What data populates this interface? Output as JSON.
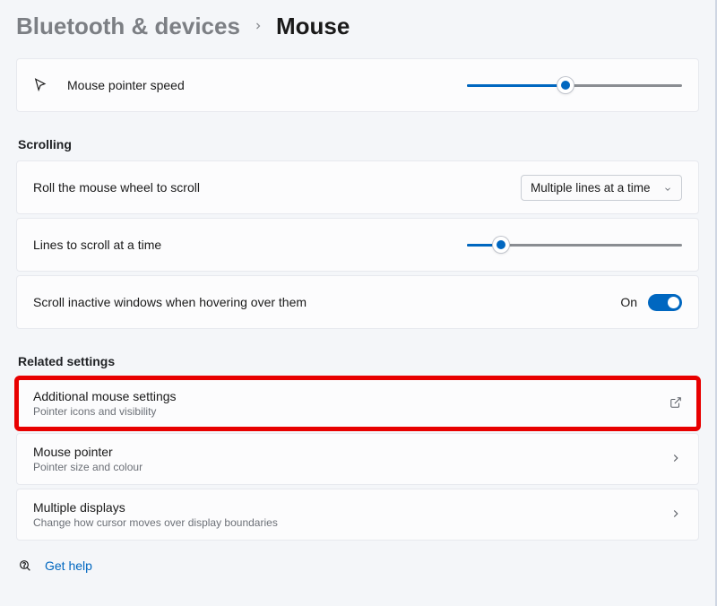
{
  "breadcrumb": {
    "parent": "Bluetooth & devices",
    "current": "Mouse"
  },
  "pointer_speed": {
    "label": "Mouse pointer speed",
    "value_percent": 46
  },
  "scrolling": {
    "section_title": "Scrolling",
    "roll_label": "Roll the mouse wheel to scroll",
    "roll_value": "Multiple lines at a time",
    "lines_label": "Lines to scroll at a time",
    "lines_value_percent": 16,
    "inactive_label": "Scroll inactive windows when hovering over them",
    "inactive_value_label": "On",
    "inactive_on": true
  },
  "related": {
    "section_title": "Related settings",
    "items": [
      {
        "title": "Additional mouse settings",
        "sub": "Pointer icons and visibility",
        "external": true,
        "highlight": true
      },
      {
        "title": "Mouse pointer",
        "sub": "Pointer size and colour",
        "external": false,
        "highlight": false
      },
      {
        "title": "Multiple displays",
        "sub": "Change how cursor moves over display boundaries",
        "external": false,
        "highlight": false
      }
    ]
  },
  "help": {
    "label": "Get help"
  }
}
